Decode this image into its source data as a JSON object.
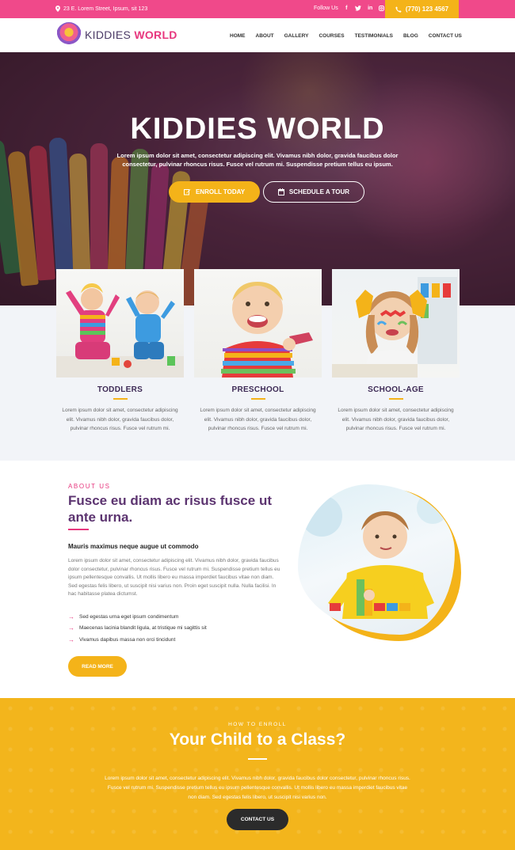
{
  "topbar": {
    "address": "23 E. Lorem Street, Ipsum, sit 123",
    "follow_label": "Follow Us",
    "social": [
      "facebook",
      "twitter",
      "linkedin",
      "instagram"
    ],
    "phone": "(770) 123 4567"
  },
  "header": {
    "logo_kiddies": "KIDDIES",
    "logo_world": "WORLD",
    "nav": [
      "HOME",
      "ABOUT",
      "GALLERY",
      "COURSES",
      "TESTIMONIALS",
      "BLOG",
      "CONTACT US"
    ]
  },
  "hero": {
    "title": "KIDDIES WORLD",
    "text": "Lorem ipsum dolor sit amet, consectetur adipiscing elit. Vivamus nibh dolor, gravida faucibus dolor consectetur, pulvinar rhoncus risus. Fusce vel rutrum mi. Suspendisse pretium tellus eu ipsum.",
    "enroll_label": "ENROLL TODAY",
    "tour_label": "SCHEDULE A TOUR"
  },
  "programs": [
    {
      "title": "TODDLERS",
      "text": "Lorem ipsum dolor sit amet, consectetur adipiscing elit. Vivamus nibh dolor, gravida faucibus dolor, pulvinar rhoncus risus. Fusce vel rutrum mi."
    },
    {
      "title": "PRESCHOOL",
      "text": "Lorem ipsum dolor sit amet, consectetur adipiscing elit. Vivamus nibh dolor, gravida faucibus dolor, pulvinar rhoncus risus. Fusce vel rutrum mi."
    },
    {
      "title": "SCHOOL-AGE",
      "text": "Lorem ipsum dolor sit amet, consectetur adipiscing elit. Vivamus nibh dolor, gravida faucibus dolor, pulvinar rhoncus risus. Fusce vel rutrum mi."
    }
  ],
  "about": {
    "tag": "ABOUT US",
    "title": "Fusce eu diam ac risus fusce ut ante urna.",
    "subtitle": "Mauris maximus neque augue ut commodo",
    "body": "Lorem ipsum dolor sit amet, consectetur adipiscing elit. Vivamus nibh dolor, gravida faucibus dolor consectetur, pulvinar rhoncus risus. Fusce vel rutrum mi. Suspendisse pretium tellus eu ipsum pellentesque convallis. Ut mollis libero eu massa imperdiet faucibus vitae non diam. Sed egestas felis libero, ut suscipit nisi varius non. Proin eget suscipit nulla. Nulla facilisi. In hac habitasse platea dictumst.",
    "list": [
      "Sed egestas urna eget ipsum condimentum",
      "Maecenas lacinia blandit ligula, at tristique mi sagittis sit",
      "Vivamus dapibus massa non orci tincidunt"
    ],
    "button": "READ MORE"
  },
  "enroll": {
    "tag": "HOW TO ENROLL",
    "title": "Your Child to a Class?",
    "body": "Lorem ipsum dolor sit amet, consectetur adipiscing elit. Vivamus nibh dolor, gravida faucibus dolor consectetur, pulvinar rhoncus risus. Fusce vel rutrum mi. Suspendisse pretium tellus eu ipsum pellentesque convallis. Ut mollis libero eu massa imperdiet faucibus vitae non diam. Sed egestas felis libero, ut suscipit nisi varius non.",
    "button": "CONTACT US"
  },
  "colors": {
    "pink": "#f0498a",
    "yellow": "#f4b319",
    "purple": "#5c3470",
    "dark": "#2b2b2b"
  }
}
